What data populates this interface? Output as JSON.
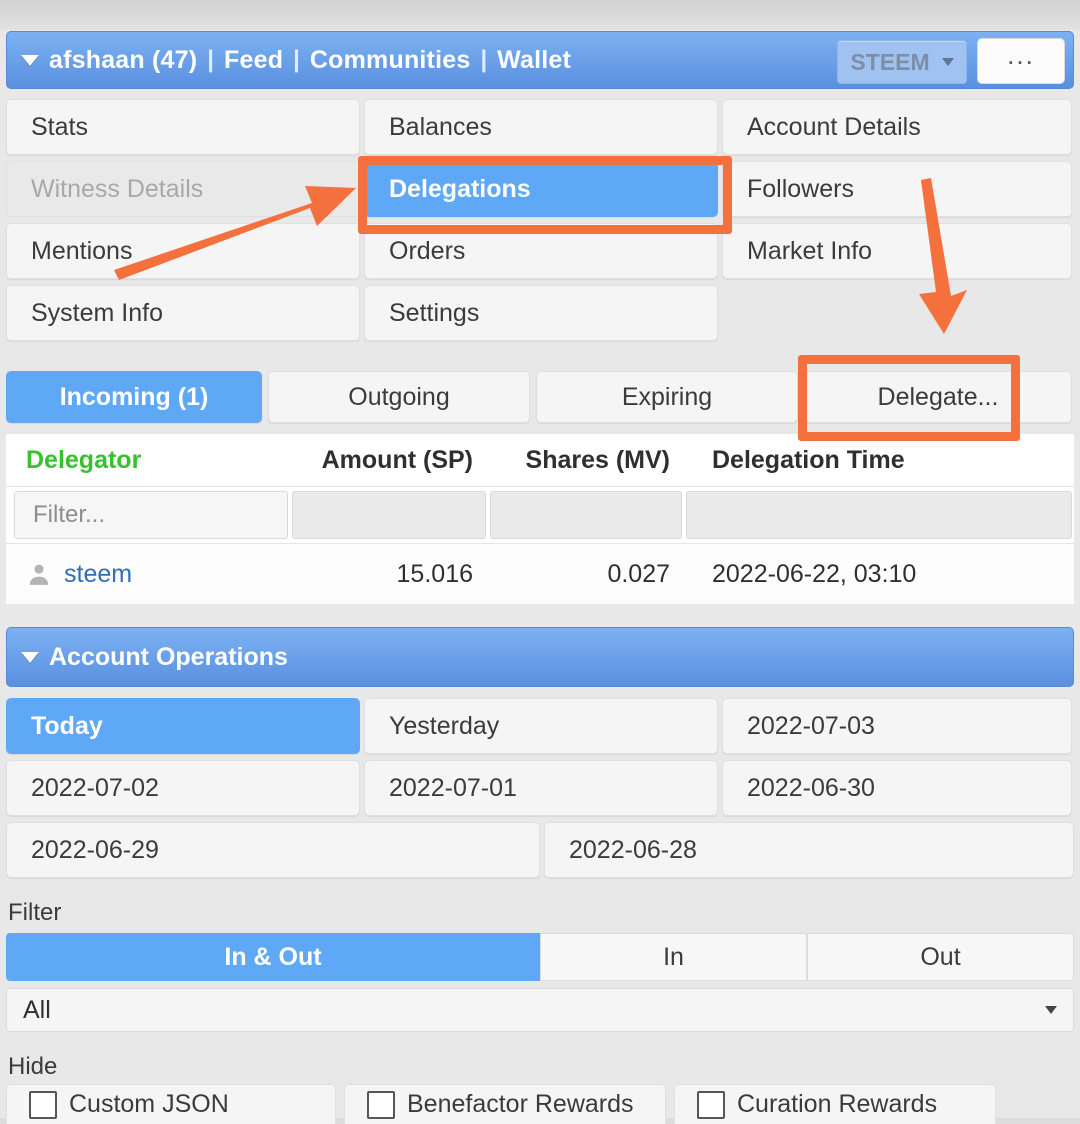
{
  "header": {
    "account": "afshaan (47)",
    "caret_icon": "caret-down-icon",
    "links": [
      "Feed",
      "Communities",
      "Wallet"
    ],
    "separator": "|",
    "currency": "STEEM",
    "more_label": "..."
  },
  "nav": {
    "rows": [
      [
        {
          "label": "Stats",
          "state": "normal"
        },
        {
          "label": "Balances",
          "state": "normal"
        },
        {
          "label": "Account Details",
          "state": "normal"
        }
      ],
      [
        {
          "label": "Witness Details",
          "state": "disabled"
        },
        {
          "label": "Delegations",
          "state": "active"
        },
        {
          "label": "Followers",
          "state": "normal"
        }
      ],
      [
        {
          "label": "Mentions",
          "state": "normal"
        },
        {
          "label": "Orders",
          "state": "normal"
        },
        {
          "label": "Market Info",
          "state": "normal"
        }
      ],
      [
        {
          "label": "System Info",
          "state": "normal"
        },
        {
          "label": "Settings",
          "state": "normal"
        },
        {
          "label": "",
          "state": "empty"
        }
      ]
    ]
  },
  "subtabs": [
    {
      "label": "Incoming (1)",
      "active": true
    },
    {
      "label": "Outgoing",
      "active": false
    },
    {
      "label": "Expiring",
      "active": false
    },
    {
      "label": "Delegate...",
      "active": false
    }
  ],
  "table": {
    "columns": [
      "Delegator",
      "Amount (SP)",
      "Shares (MV)",
      "Delegation Time"
    ],
    "filter_placeholder": "Filter...",
    "rows": [
      {
        "delegator": "steem",
        "amount": "15.016",
        "shares": "0.027",
        "time": "2022-06-22, 03:10",
        "icon": "user-icon"
      }
    ]
  },
  "operations": {
    "title": "Account Operations",
    "caret_icon": "caret-down-icon",
    "dates": [
      [
        {
          "label": "Today",
          "active": true
        },
        {
          "label": "Yesterday",
          "active": false
        },
        {
          "label": "2022-07-03",
          "active": false
        }
      ],
      [
        {
          "label": "2022-07-02",
          "active": false
        },
        {
          "label": "2022-07-01",
          "active": false
        },
        {
          "label": "2022-06-30",
          "active": false
        }
      ],
      [
        {
          "label": "2022-06-29",
          "active": false
        },
        {
          "label": "2022-06-28",
          "active": false
        }
      ]
    ],
    "filter_label": "Filter",
    "segments": [
      {
        "label": "In & Out",
        "active": true
      },
      {
        "label": "In",
        "active": false
      },
      {
        "label": "Out",
        "active": false
      }
    ],
    "type_select": {
      "value": "All",
      "icon": "chevron-down-icon"
    },
    "hide_label": "Hide",
    "hide_options": [
      {
        "label": "Custom JSON",
        "checked": false
      },
      {
        "label": "Benefactor Rewards",
        "checked": false
      },
      {
        "label": "Curation Rewards",
        "checked": false
      }
    ]
  },
  "annotations": {
    "color": "#f4703c",
    "highlight_delegations": "Delegations",
    "highlight_delegate": "Delegate...",
    "arrow1": "arrow-pointing-to-delegations",
    "arrow2": "arrow-pointing-to-delegate"
  }
}
